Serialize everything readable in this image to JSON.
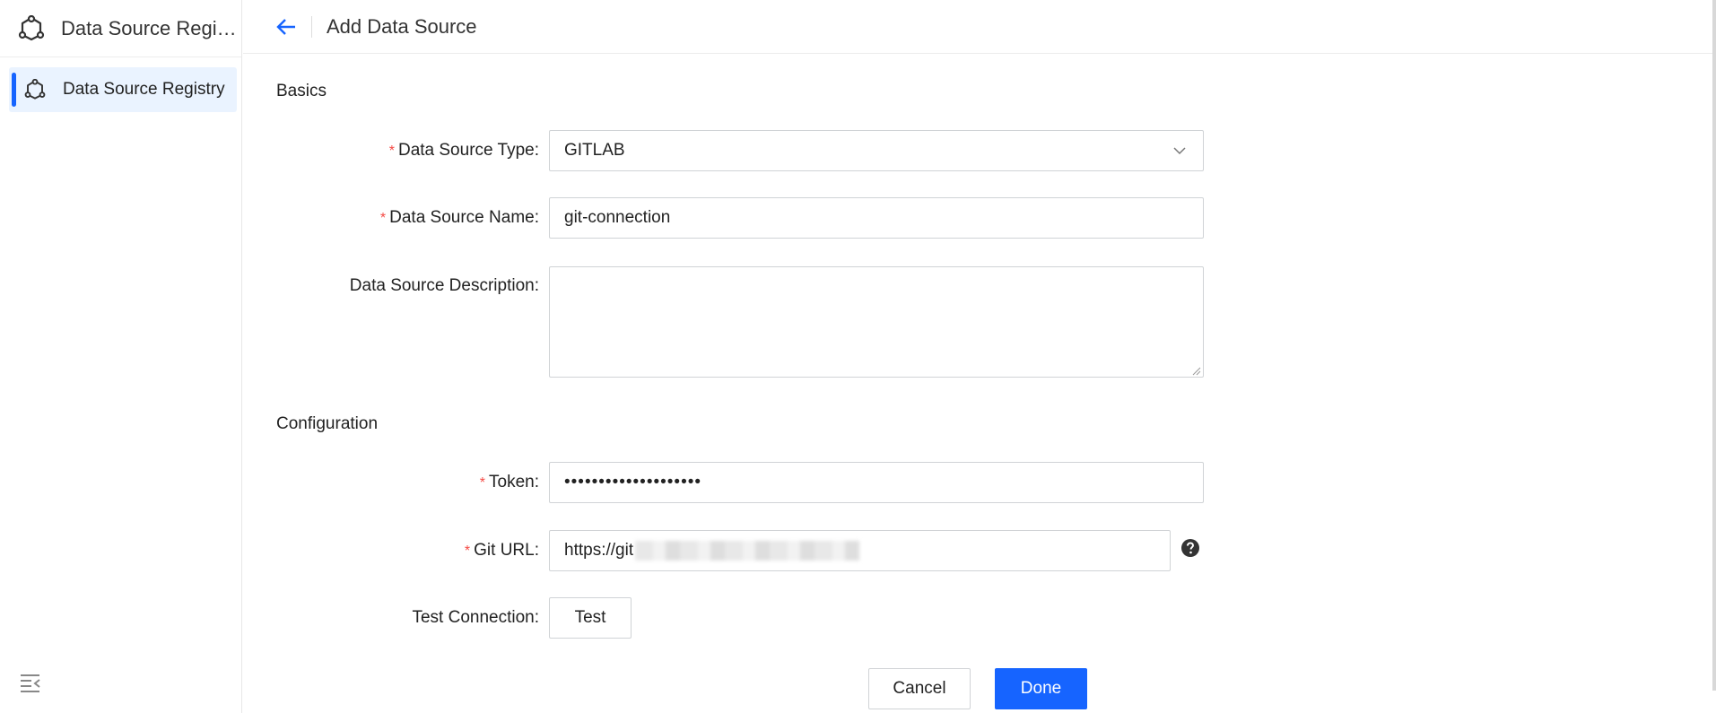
{
  "app": {
    "title": "Data Source Registry"
  },
  "sidebar": {
    "items": [
      {
        "label": "Data Source Registry",
        "active": true
      }
    ]
  },
  "header": {
    "title": "Add Data Source"
  },
  "sections": {
    "basics": "Basics",
    "configuration": "Configuration"
  },
  "form": {
    "type": {
      "label": "Data Source Type:",
      "value": "GITLAB",
      "required": true
    },
    "name": {
      "label": "Data Source Name:",
      "value": "git-connection",
      "required": true
    },
    "description": {
      "label": "Data Source Description:",
      "value": ""
    },
    "token": {
      "label": "Token:",
      "value": "••••••••••••••••••••",
      "required": true
    },
    "git_url": {
      "label": "Git URL:",
      "value": "https://git",
      "required": true
    },
    "test_connection": {
      "label": "Test Connection:",
      "button": "Test"
    }
  },
  "actions": {
    "cancel": "Cancel",
    "done": "Done"
  },
  "colors": {
    "primary": "#1664ff",
    "required": "#f54a45",
    "active_bg": "#eaf3ff"
  }
}
